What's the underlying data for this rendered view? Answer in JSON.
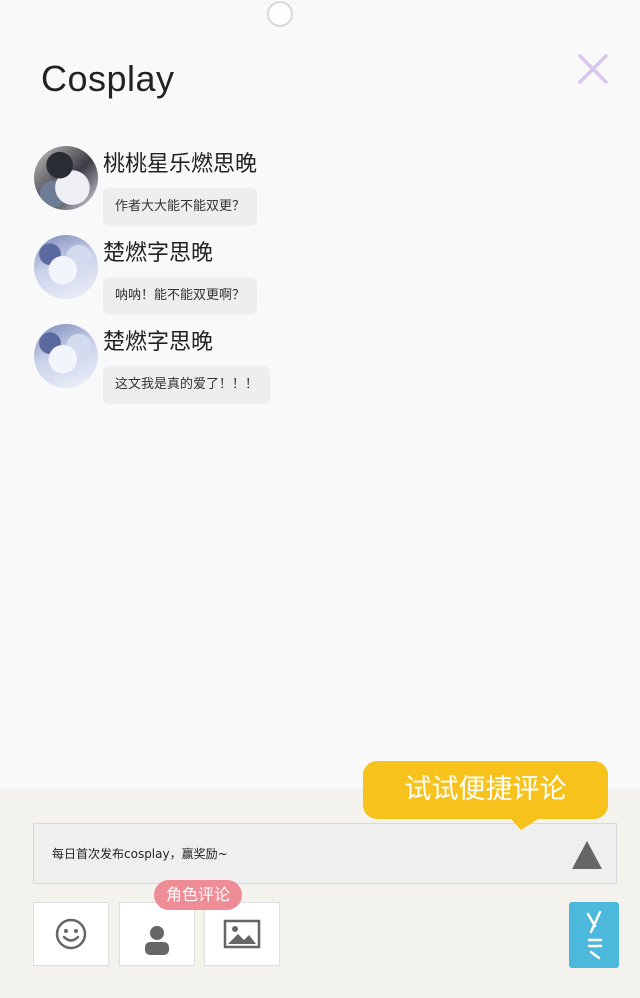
{
  "header": {
    "title": "Cosplay",
    "close_icon": "close-x-icon",
    "accent_color": "#d7c6ee"
  },
  "comments": [
    {
      "username": "桃桃星乐燃思晚",
      "text": "作者大大能不能双更？",
      "avatar": "avatar-dark"
    },
    {
      "username": "楚燃字思晚",
      "text": "呐呐！能不能双更啊？",
      "avatar": "avatar-light"
    },
    {
      "username": "楚燃字思晚",
      "text": "这文我是真的爱了！！！",
      "avatar": "avatar-light"
    }
  ],
  "composer": {
    "tip_label": "试试便捷评论",
    "tip_color": "#f7c21b",
    "placeholder": "每日首次发布cosplay，赢奖励~",
    "send_icon": "triangle-up-icon",
    "role_badge": "角色评论",
    "role_badge_color": "#ee8d96",
    "tools": [
      "emoji-icon",
      "person-icon",
      "image-icon"
    ],
    "side_tag_icon": "side-tag-icon",
    "side_tag_color": "#4bb8dc"
  }
}
